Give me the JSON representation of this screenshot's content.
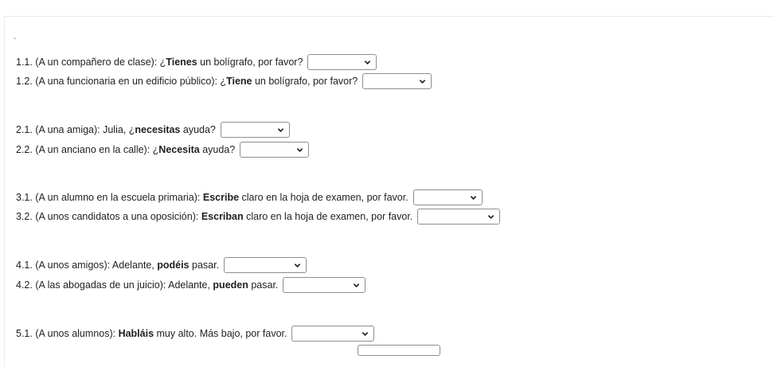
{
  "marker": ".",
  "questions": [
    {
      "id": "q1_1",
      "num": "1.1.",
      "prefix": "(A un compañero de clase): ¿",
      "verb": "Tienes",
      "suffix": " un bolígrafo, por favor?",
      "selected": ""
    },
    {
      "id": "q1_2",
      "num": "1.2.",
      "prefix": "(A una funcionaria en un edificio público): ¿",
      "verb": "Tiene",
      "suffix": " un bolígrafo, por favor?",
      "selected": ""
    },
    {
      "id": "q2_1",
      "num": "2.1.",
      "prefix": "(A una amiga): Julia, ¿",
      "verb": "necesitas",
      "suffix": " ayuda?",
      "selected": ""
    },
    {
      "id": "q2_2",
      "num": "2.2.",
      "prefix": "(A un anciano en la calle): ¿",
      "verb": "Necesita",
      "suffix": " ayuda?",
      "selected": ""
    },
    {
      "id": "q3_1",
      "num": "3.1.",
      "prefix": "(A un alumno en la escuela primaria): ",
      "verb": "Escribe",
      "suffix": " claro en la hoja de examen, por favor.",
      "selected": ""
    },
    {
      "id": "q3_2",
      "num": "3.2.",
      "prefix": "(A unos candidatos a una oposición): ",
      "verb": "Escriban",
      "suffix": " claro en la hoja de examen, por favor.",
      "selected": ""
    },
    {
      "id": "q4_1",
      "num": "4.1.",
      "prefix": "(A unos amigos): Adelante, ",
      "verb": "podéis",
      "suffix": " pasar.",
      "selected": ""
    },
    {
      "id": "q4_2",
      "num": "4.2.",
      "prefix": "(A las abogadas de un juicio): Adelante, ",
      "verb": "pueden",
      "suffix": " pasar.",
      "selected": ""
    },
    {
      "id": "q5_1",
      "num": "5.1.",
      "prefix": "(A unos alumnos): ",
      "verb": "Habláis",
      "suffix": " muy alto. Más bajo, por favor.",
      "selected": ""
    }
  ]
}
